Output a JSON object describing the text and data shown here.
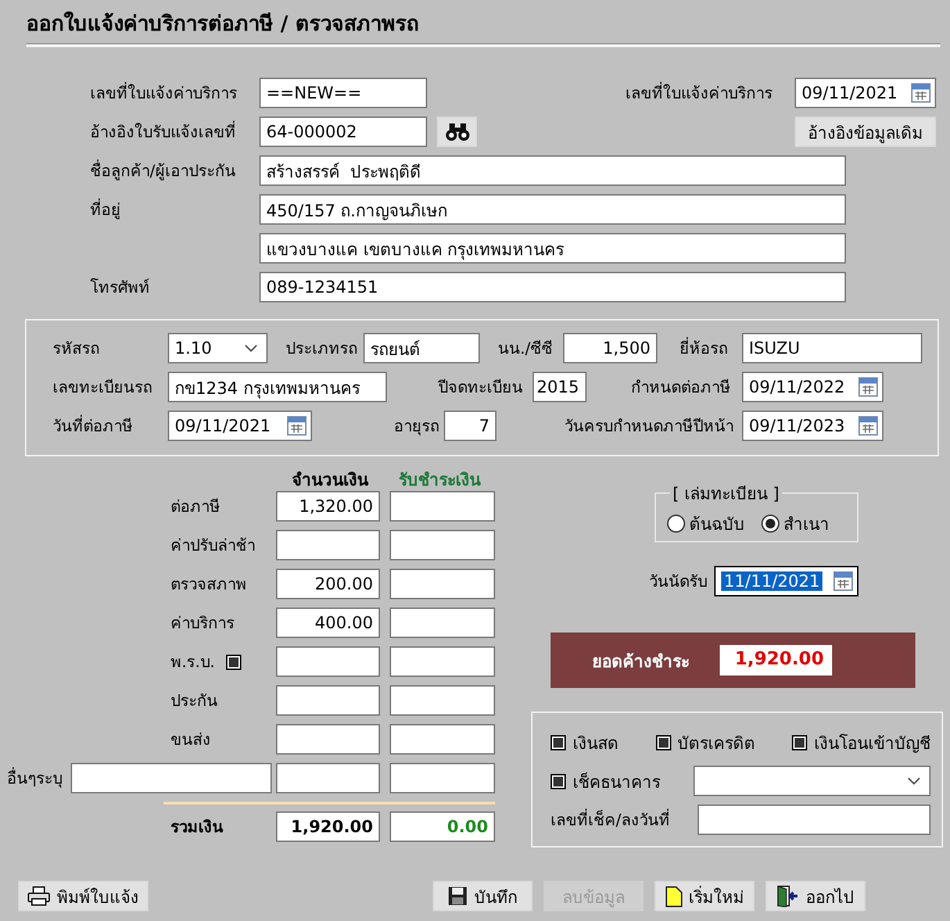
{
  "title": "ออกใบแจ้งค่าบริการต่อภาษี / ตรวจสภาพรถ",
  "top": {
    "notice_no": {
      "label": "เลขที่ใบแจ้งค่าบริการ",
      "value": "==NEW=="
    },
    "notice_date": {
      "label": "เลขที่ใบแจ้งค่าบริการ",
      "value": "09/11/2021"
    },
    "receipt_ref": {
      "label": "อ้างอิงใบรับแจ้งเลขที่",
      "value": "64-000002"
    },
    "ref_button": "อ้างอิงข้อมูลเดิม",
    "customer": {
      "label": "ชื่อลูกค้า/ผู้เอาประกัน",
      "value": "สร้างสรรค์  ประพฤติดี"
    },
    "address": {
      "label": "ที่อยู่",
      "lines": [
        "450/157 ถ.กาญจนภิเษก",
        "แขวงบางแค เขตบางแค กรุงเทพมหานคร"
      ]
    },
    "phone": {
      "label": "โทรศัพท์",
      "value": "089-1234151"
    }
  },
  "vehicle": {
    "code": {
      "label": "รหัสรถ",
      "value": "1.10"
    },
    "type": {
      "label": "ประเภทรถ",
      "value": "รถยนต์"
    },
    "weight": {
      "label": "นน./ซีซี",
      "value": "1,500"
    },
    "brand": {
      "label": "ยี่ห้อรถ",
      "value": "ISUZU"
    },
    "plate": {
      "label": "เลขทะเบียนรถ",
      "value": "กข1234 กรุงเทพมหานคร"
    },
    "reg_year": {
      "label": "ปีจดทะเบียน",
      "value": "2015"
    },
    "tax_due": {
      "label": "กำหนดต่อภาษี",
      "value": "09/11/2022"
    },
    "tax_date": {
      "label": "วันที่ต่อภาษี",
      "value": "09/11/2021"
    },
    "age": {
      "label": "อายุรถ",
      "value": "7"
    },
    "next_due": {
      "label": "วันครบกำหนดภาษีปีหน้า",
      "value": "09/11/2023"
    }
  },
  "amounts": {
    "headers": [
      "จำนวนเงิน",
      "รับชำระเงิน"
    ],
    "rows": [
      {
        "kind": "plain",
        "label": "ต่อภาษี",
        "amount": "1,320.00"
      },
      {
        "kind": "plain",
        "label": "ค่าปรับล่าช้า"
      },
      {
        "kind": "plain",
        "label": "ตรวจสภาพ",
        "amount": "200.00"
      },
      {
        "kind": "plain",
        "label": "ค่าบริการ",
        "amount": "400.00"
      },
      {
        "kind": "checkbox",
        "label": "พ.ร.บ.",
        "checked": true
      },
      {
        "kind": "plain",
        "label": "ประกัน"
      },
      {
        "kind": "plain",
        "label": "ขนส่ง"
      },
      {
        "kind": "other",
        "label": "อื่นๆระบุ"
      }
    ],
    "total": {
      "label": "รวมเงิน",
      "amount": "1,920.00",
      "paid": "0.00"
    }
  },
  "book": {
    "legend": "[ เล่มทะเบียน ]",
    "options": [
      {
        "label": "ต้นฉบับ",
        "selected": false
      },
      {
        "label": "สำเนา",
        "selected": true
      }
    ]
  },
  "pickup": {
    "label": "วันนัดรับ",
    "value": "11/11/2021"
  },
  "balance": {
    "label": "ยอดค้างชำระ",
    "value": "1,920.00"
  },
  "payment": {
    "methods": [
      {
        "label": "เงินสด",
        "checked": true
      },
      {
        "label": "บัตรเครดิต",
        "checked": true
      },
      {
        "label": "เงินโอนเข้าบัญชี",
        "checked": true
      },
      {
        "label": "เช็คธนาคาร",
        "checked": true
      }
    ],
    "cheque_no": {
      "label": "เลขที่เช็ค/ลงวันที่"
    }
  },
  "buttons": [
    {
      "kind": "print",
      "label": "พิมพ์ใบแจ้ง",
      "disabled": false
    },
    {
      "kind": "save",
      "label": "บันทึก",
      "disabled": false
    },
    {
      "kind": "delete",
      "label": "ลบข้อมูล",
      "disabled": true
    },
    {
      "kind": "new",
      "label": "เริ่มใหม่",
      "disabled": false
    },
    {
      "kind": "exit",
      "label": "ออกไป",
      "disabled": false
    }
  ]
}
